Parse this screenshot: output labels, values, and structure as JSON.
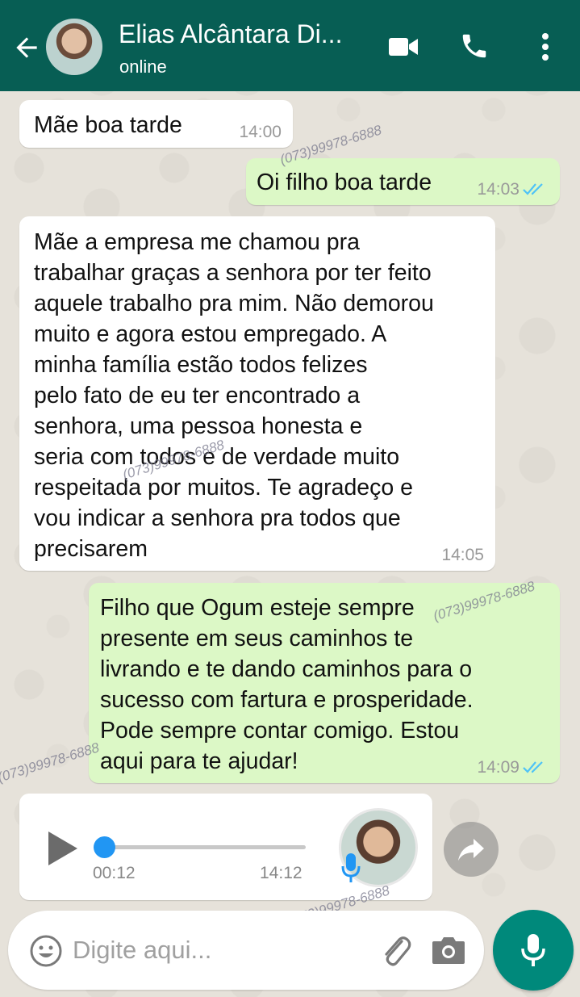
{
  "header": {
    "contact_name": "Elias Alcântara Di...",
    "status": "online"
  },
  "messages": [
    {
      "direction": "in",
      "text": "Mãe boa tarde",
      "time": "14:00"
    },
    {
      "direction": "out",
      "text": "Oi filho boa tarde",
      "time": "14:03",
      "read": true
    },
    {
      "direction": "in",
      "text": "Mãe a empresa me chamou pra\ntrabalhar graças a senhora por ter feito\naquele trabalho pra mim. Não demorou\nmuito e agora estou empregado. A\nminha família estão todos felizes\npelo fato de eu ter encontrado a\nsenhora, uma pessoa honesta e\nseria com todos e de verdade muito\nrespeitada por muitos. Te agradeço e\nvou indicar a senhora pra todos que\nprecisarem",
      "time": "14:05"
    },
    {
      "direction": "out",
      "text": "Filho que Ogum  esteje sempre\npresente em seus caminhos te\nlivrando e te dando caminhos para o\nsucesso com fartura e prosperidade.\nPode sempre contar comigo. Estou\naqui para te ajudar!",
      "time": "14:09",
      "read": true
    }
  ],
  "audio_message": {
    "duration": "00:12",
    "time": "14:12",
    "progress": 0
  },
  "composer": {
    "placeholder": "Digite aqui..."
  },
  "watermark_text": "(073)99978-6888",
  "colors": {
    "header": "#075e54",
    "outgoing": "#dcf8c6",
    "incoming": "#ffffff",
    "read_ticks": "#4fc3f7",
    "mic_button": "#00897b"
  }
}
